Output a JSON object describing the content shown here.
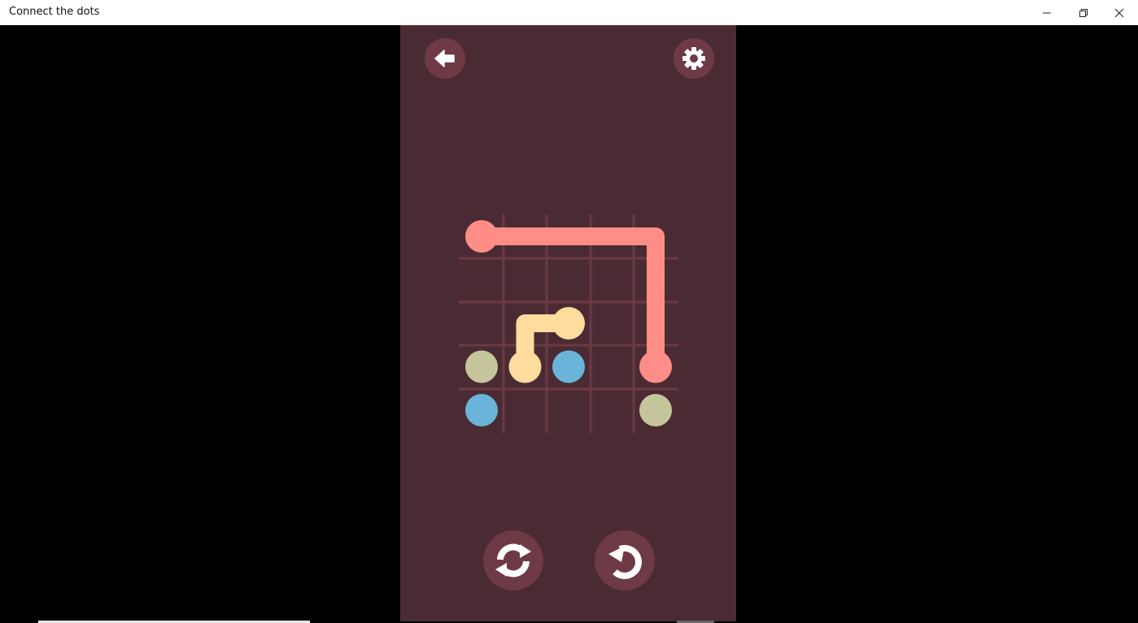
{
  "window": {
    "title": "Connect the dots",
    "controls": [
      "minimize-icon",
      "restore-icon",
      "close-icon"
    ]
  },
  "toolbar": {
    "back_icon": "arrow-left-icon",
    "settings_icon": "gear-icon",
    "shuffle_icon": "refresh-icon",
    "undo_icon": "undo-icon"
  },
  "colors": {
    "panel_background": "#4b2b33",
    "button_background": "#6e3a46",
    "grid_line": "#6b3a45",
    "salmon": "#fe8d87",
    "yellow": "#fedc9e",
    "blue": "#69b4d8",
    "olive": "#c5c59b"
  },
  "puzzle": {
    "grid_columns": 5,
    "grid_rows": 5,
    "dots": [
      {
        "color": "salmon",
        "col": 0,
        "row": 0
      },
      {
        "color": "salmon",
        "col": 4,
        "row": 3
      },
      {
        "color": "yellow",
        "col": 2,
        "row": 2
      },
      {
        "color": "yellow",
        "col": 1,
        "row": 3
      },
      {
        "color": "olive",
        "col": 0,
        "row": 3
      },
      {
        "color": "olive",
        "col": 4,
        "row": 4
      },
      {
        "color": "blue",
        "col": 2,
        "row": 3
      },
      {
        "color": "blue",
        "col": 0,
        "row": 4
      }
    ],
    "paths": [
      {
        "color": "salmon",
        "cells": [
          [
            0,
            0
          ],
          [
            1,
            0
          ],
          [
            2,
            0
          ],
          [
            3,
            0
          ],
          [
            4,
            0
          ],
          [
            4,
            1
          ],
          [
            4,
            2
          ],
          [
            4,
            3
          ]
        ]
      },
      {
        "color": "yellow",
        "cells": [
          [
            2,
            2
          ],
          [
            1,
            2
          ],
          [
            1,
            3
          ]
        ]
      }
    ]
  }
}
